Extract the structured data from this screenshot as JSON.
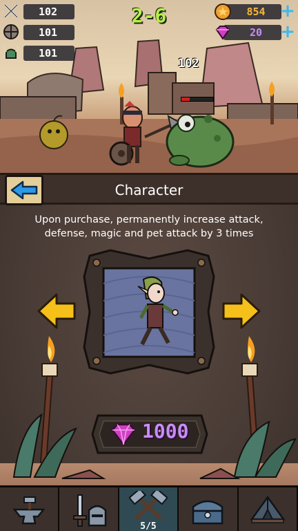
{
  "hud": {
    "attack": "102",
    "defense": "101",
    "magic": "101",
    "stage": "2-6",
    "gold": "854",
    "gems": "20",
    "plus_label": "+"
  },
  "battle": {
    "damage_popup": "102",
    "enemy_hp_fraction": 0.25
  },
  "panel": {
    "title": "Character",
    "description": "Upon purchase, permanently increase attack, defense, magic and pet attack by 3 times",
    "price": "1000"
  },
  "nav": {
    "items": [
      {
        "name": "forge",
        "icon": "anvil-hammer-icon"
      },
      {
        "name": "equipment",
        "icon": "sword-helmet-icon"
      },
      {
        "name": "battle",
        "icon": "crossed-hammers-icon",
        "badge": "5/5"
      },
      {
        "name": "chest",
        "icon": "treasure-chest-icon"
      },
      {
        "name": "shop",
        "icon": "tent-icon"
      }
    ]
  },
  "colors": {
    "stage_green": "#b8f04a",
    "gold_text": "#f5b83a",
    "gem_text": "#c98cf6",
    "accent_blue": "#3ab8f0",
    "arrow_yellow": "#f5c01a"
  }
}
